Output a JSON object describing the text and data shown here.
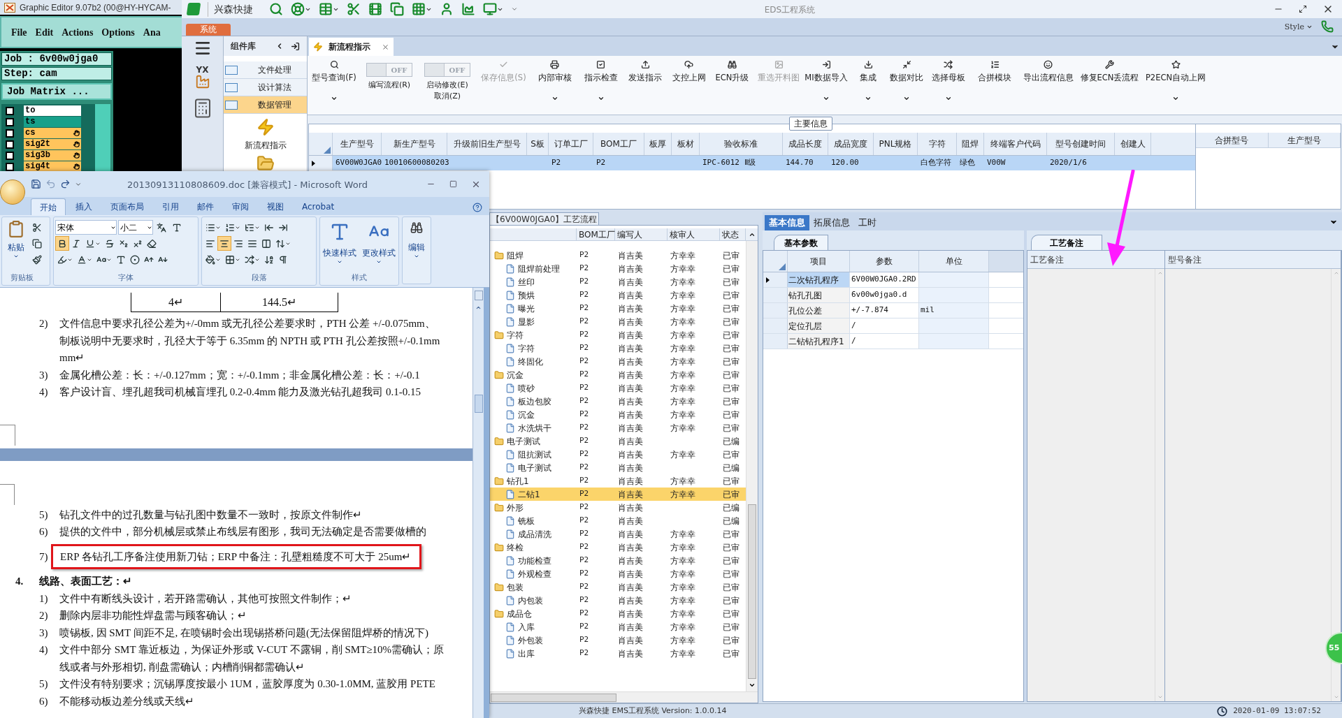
{
  "graphic_editor": {
    "title": "Graphic Editor 9.07b2 (00@HY-HYCAM-",
    "menu": [
      "File",
      "Edit",
      "Actions",
      "Options",
      "Ana"
    ],
    "job": "Job : 6v00w0jga0",
    "step": "Step: cam",
    "matrix_button": "Job Matrix ...",
    "layers": [
      {
        "name": "to",
        "color": "#ffffff",
        "kind": "plain",
        "checked": false
      },
      {
        "name": "ts",
        "color": "#17a08a",
        "kind": "plain",
        "checked": false
      },
      {
        "name": "cs",
        "color": "#ffc45c",
        "kind": "signal",
        "checked": false
      },
      {
        "name": "sig2t",
        "color": "#ffc45c",
        "kind": "signal",
        "checked": false
      },
      {
        "name": "sig3b",
        "color": "#ffc45c",
        "kind": "signal",
        "checked": false
      },
      {
        "name": "sig4t",
        "color": "#ffc45c",
        "kind": "signal",
        "checked": false
      }
    ]
  },
  "eds": {
    "title": "EDS工程系统",
    "quick_access_label": "兴森快捷",
    "system_tab": "系统",
    "style_label": "Style",
    "nav_badge": "YX",
    "component_panel": {
      "title": "组件库",
      "items": [
        {
          "label": "文件处理",
          "selected": false
        },
        {
          "label": "设计算法",
          "selected": false
        },
        {
          "label": "数据管理",
          "selected": true
        }
      ],
      "tool": "新流程指示"
    },
    "tabs": [
      {
        "label": "新流程指示",
        "selected": true
      }
    ],
    "ribbon": [
      {
        "kind": "button",
        "label": "型号查询(F)",
        "has_menu": true,
        "disabled": false
      },
      {
        "kind": "toggle",
        "state_text": "OFF",
        "on": false,
        "label": "编写流程(R)"
      },
      {
        "kind": "toggle",
        "state_text": "OFF",
        "on": false,
        "label": "启动修改(E)",
        "sub_label": "取消(Z)"
      },
      {
        "kind": "button",
        "label": "保存信息(S)",
        "has_menu": false,
        "disabled": true
      },
      {
        "kind": "button",
        "label": "内部审核",
        "has_menu": true,
        "disabled": false
      },
      {
        "kind": "button",
        "label": "指示检查",
        "has_menu": true,
        "disabled": false
      },
      {
        "kind": "button",
        "label": "发送指示",
        "has_menu": false,
        "disabled": false
      },
      {
        "kind": "button",
        "label": "文控上网",
        "has_menu": false,
        "disabled": false
      },
      {
        "kind": "button",
        "label": "ECN升级",
        "has_menu": false,
        "disabled": false
      },
      {
        "kind": "button",
        "label": "重选开料图",
        "has_menu": false,
        "disabled": true
      },
      {
        "kind": "button",
        "label": "MI数据导入",
        "has_menu": true,
        "disabled": false
      },
      {
        "kind": "button",
        "label": "集成",
        "has_menu": true,
        "disabled": false
      },
      {
        "kind": "button",
        "label": "数据对比",
        "has_menu": true,
        "disabled": false
      },
      {
        "kind": "button",
        "label": "选择母板",
        "has_menu": true,
        "disabled": false
      },
      {
        "kind": "button",
        "label": "合拼模块",
        "has_menu": false,
        "disabled": false
      },
      {
        "kind": "button",
        "label": "导出流程信息",
        "has_menu": false,
        "disabled": false
      },
      {
        "kind": "button",
        "label": "修复ECN丢流程",
        "has_menu": false,
        "disabled": false
      },
      {
        "kind": "button",
        "label": "P2ECN自动上网",
        "has_menu": true,
        "disabled": false
      }
    ],
    "main_info": {
      "caption": "主要信息",
      "columns": [
        "生产型号",
        "新生产型号",
        "升级前旧生产型号",
        "S板",
        "订单工厂",
        "BOM工厂",
        "板厚",
        "板材",
        "验收标准",
        "成品长度",
        "成品宽度",
        "PNL规格",
        "字符",
        "阻焊",
        "终端客户代码",
        "型号创建时间",
        "创建人"
      ],
      "rows": [
        {
          "selected": true,
          "cells": [
            "6V00W0JGA0",
            "10010600080203",
            null,
            null,
            "P2",
            "P2",
            null,
            null,
            "IPC-6012 Ⅱ级",
            "144.70",
            "120.00",
            null,
            "白色字符",
            "绿色",
            "V00W",
            "2020/1/6",
            null
          ]
        }
      ],
      "side_columns": [
        "合拼型号",
        "生产型号"
      ]
    },
    "process_flow": {
      "tab": "【6V00W0JGA0】工艺流程",
      "columns": [
        "BOM工厂",
        "编写人",
        "核审人",
        "状态"
      ],
      "steps": [
        {
          "name": "阻焊",
          "kind": "folder",
          "bom": "P2",
          "author": "肖吉美",
          "reviewer": "方幸幸",
          "status": "已审",
          "selected": false,
          "children": [
            {
              "name": "阻焊前处理",
              "kind": "file",
              "bom": "P2",
              "author": "肖吉美",
              "reviewer": "方幸幸",
              "status": "已审",
              "selected": false
            },
            {
              "name": "丝印",
              "kind": "file",
              "bom": "P2",
              "author": "肖吉美",
              "reviewer": "方幸幸",
              "status": "已审",
              "selected": false
            },
            {
              "name": "预烘",
              "kind": "file",
              "bom": "P2",
              "author": "肖吉美",
              "reviewer": "方幸幸",
              "status": "已审",
              "selected": false
            },
            {
              "name": "曝光",
              "kind": "file",
              "bom": "P2",
              "author": "肖吉美",
              "reviewer": "方幸幸",
              "status": "已审",
              "selected": false
            },
            {
              "name": "显影",
              "kind": "file",
              "bom": "P2",
              "author": "肖吉美",
              "reviewer": "方幸幸",
              "status": "已审",
              "selected": false
            }
          ]
        },
        {
          "name": "字符",
          "kind": "folder",
          "bom": "P2",
          "author": "肖吉美",
          "reviewer": "方幸幸",
          "status": "已审",
          "selected": false,
          "children": [
            {
              "name": "字符",
              "kind": "file",
              "bom": "P2",
              "author": "肖吉美",
              "reviewer": "方幸幸",
              "status": "已审",
              "selected": false
            },
            {
              "name": "终固化",
              "kind": "file",
              "bom": "P2",
              "author": "肖吉美",
              "reviewer": "方幸幸",
              "status": "已审",
              "selected": false
            }
          ]
        },
        {
          "name": "沉金",
          "kind": "folder",
          "bom": "P2",
          "author": "肖吉美",
          "reviewer": "方幸幸",
          "status": "已审",
          "selected": false,
          "children": [
            {
              "name": "喷砂",
              "kind": "file",
              "bom": "P2",
              "author": "肖吉美",
              "reviewer": "方幸幸",
              "status": "已审",
              "selected": false
            },
            {
              "name": "板边包胶",
              "kind": "file",
              "bom": "P2",
              "author": "肖吉美",
              "reviewer": "方幸幸",
              "status": "已审",
              "selected": false
            },
            {
              "name": "沉金",
              "kind": "file",
              "bom": "P2",
              "author": "肖吉美",
              "reviewer": "方幸幸",
              "status": "已审",
              "selected": false
            },
            {
              "name": "水洗烘干",
              "kind": "file",
              "bom": "P2",
              "author": "肖吉美",
              "reviewer": "方幸幸",
              "status": "已审",
              "selected": false
            }
          ]
        },
        {
          "name": "电子测试",
          "kind": "folder",
          "bom": "P2",
          "author": "肖吉美",
          "status": "已编",
          "selected": false,
          "children": [
            {
              "name": "阻抗测试",
              "kind": "file",
              "bom": "P2",
              "author": "肖吉美",
              "reviewer": "方幸幸",
              "status": "已审",
              "selected": false
            },
            {
              "name": "电子测试",
              "kind": "file",
              "bom": "P2",
              "author": "肖吉美",
              "status": "已编",
              "selected": false
            }
          ]
        },
        {
          "name": "钻孔1",
          "kind": "folder",
          "bom": "P2",
          "author": "肖吉美",
          "reviewer": "方幸幸",
          "status": "已审",
          "selected": false,
          "children": [
            {
              "name": "二钻1",
              "kind": "file",
              "bom": "P2",
              "author": "肖吉美",
              "reviewer": "方幸幸",
              "status": "已审",
              "selected": true
            }
          ]
        },
        {
          "name": "外形",
          "kind": "folder",
          "bom": "P2",
          "author": "肖吉美",
          "status": "已编",
          "selected": false,
          "children": [
            {
              "name": "铣板",
              "kind": "file",
              "bom": "P2",
              "author": "肖吉美",
              "status": "已编",
              "selected": false
            },
            {
              "name": "成品清洗",
              "kind": "file",
              "bom": "P2",
              "author": "肖吉美",
              "reviewer": "方幸幸",
              "status": "已审",
              "selected": false
            }
          ]
        },
        {
          "name": "终检",
          "kind": "folder",
          "bom": "P2",
          "author": "肖吉美",
          "reviewer": "方幸幸",
          "status": "已审",
          "selected": false,
          "children": [
            {
              "name": "功能检查",
              "kind": "file",
              "bom": "P2",
              "author": "肖吉美",
              "reviewer": "方幸幸",
              "status": "已审",
              "selected": false
            },
            {
              "name": "外观检查",
              "kind": "file",
              "bom": "P2",
              "author": "肖吉美",
              "reviewer": "方幸幸",
              "status": "已审",
              "selected": false
            }
          ]
        },
        {
          "name": "包装",
          "kind": "folder",
          "bom": "P2",
          "author": "肖吉美",
          "reviewer": "方幸幸",
          "status": "已审",
          "selected": false,
          "children": [
            {
              "name": "内包装",
              "kind": "file",
              "bom": "P2",
              "author": "肖吉美",
              "reviewer": "方幸幸",
              "status": "已审",
              "selected": false
            }
          ]
        },
        {
          "name": "成品仓",
          "kind": "folder",
          "bom": "P2",
          "author": "肖吉美",
          "reviewer": "方幸幸",
          "status": "已审",
          "selected": false,
          "children": [
            {
              "name": "入库",
              "kind": "file",
              "bom": "P2",
              "author": "肖吉美",
              "reviewer": "方幸幸",
              "status": "已审",
              "selected": false
            },
            {
              "name": "外包装",
              "kind": "file",
              "bom": "P2",
              "author": "肖吉美",
              "reviewer": "方幸幸",
              "status": "已审",
              "selected": false
            },
            {
              "name": "出库",
              "kind": "file",
              "bom": "P2",
              "author": "肖吉美",
              "reviewer": "方幸幸",
              "status": "已审",
              "selected": false
            }
          ]
        }
      ]
    },
    "detail_tabs": [
      {
        "label": "基本信息",
        "selected": true
      },
      {
        "label": "拓展信息",
        "selected": false
      },
      {
        "label": "工时",
        "selected": false
      }
    ],
    "basic_params": {
      "tab": "基本参数",
      "columns": [
        "项目",
        "参数",
        "单位"
      ],
      "rows": [
        {
          "item": "二次钻孔程序",
          "value": "6V00W0JGA0.2RD",
          "selected": true
        },
        {
          "item": "钻孔孔图",
          "value": "6v00w0jga0.d",
          "selected": false
        },
        {
          "item": "孔位公差",
          "value": "+/-7.874",
          "unit": "mil",
          "selected": false
        },
        {
          "item": "定位孔层",
          "value": "/",
          "selected": false
        },
        {
          "item": "二钻钻孔程序1",
          "value": "/",
          "selected": false
        }
      ]
    },
    "notes": {
      "tab": "工艺备注",
      "columns": [
        "工艺备注",
        "型号备注"
      ]
    },
    "status_bar": {
      "text": "兴森快捷 EMS工程系统 Version: 1.0.0.14",
      "datetime": "2020-01-09 13:07:52"
    },
    "badge": "55"
  },
  "word": {
    "title": "20130913110808609.doc [兼容模式] - Microsoft Word",
    "tabs": [
      {
        "label": "开始",
        "selected": true
      },
      {
        "label": "插入",
        "selected": false
      },
      {
        "label": "页面布局",
        "selected": false
      },
      {
        "label": "引用",
        "selected": false
      },
      {
        "label": "邮件",
        "selected": false
      },
      {
        "label": "审阅",
        "selected": false
      },
      {
        "label": "视图",
        "selected": false
      },
      {
        "label": "Acrobat",
        "selected": false
      }
    ],
    "ribbon": {
      "paste": "粘贴",
      "font_name": "宋体",
      "font_size": "小二",
      "bold": true,
      "align_buttons": [
        {
          "selected": false
        },
        {
          "selected": true
        },
        {
          "selected": false
        },
        {
          "selected": false
        },
        {
          "selected": false
        }
      ],
      "quick_styles": "快速样式",
      "change_styles": "更改样式",
      "edit": "编辑",
      "groups": [
        "剪贴板",
        "字体",
        "段落",
        "样式"
      ]
    },
    "document": {
      "table_cells": [
        "4↵",
        "144.5↵"
      ],
      "blocks": [
        {
          "kind": "item",
          "number": "2)",
          "highlighted": false,
          "lines": [
            "文件信息中要求孔径公差为+/-0mm 或无孔径公差要求时，PTH 公差 +/-0.075mm、",
            "制板说明中无要求时，孔径大于等于 6.35mm 的 NPTH 或 PTH 孔公差按照+/-0.1mm",
            "mm↵"
          ]
        },
        {
          "kind": "item",
          "number": "3)",
          "highlighted": false,
          "lines": [
            "金属化槽公差：长：+/-0.127mm；宽：+/-0.1mm；非金属化槽公差：长：+/-0.1"
          ]
        },
        {
          "kind": "item",
          "number": "4)",
          "highlighted": false,
          "lines": [
            "客户设计盲、埋孔超我司机械盲埋孔 0.2-0.4mm 能力及激光钻孔超我司 0.1-0.15"
          ]
        },
        {
          "kind": "page_break"
        },
        {
          "kind": "item",
          "number": "5)",
          "highlighted": false,
          "lines": [
            "钻孔文件中的过孔数量与钻孔图中数量不一致时，按原文件制作↵"
          ]
        },
        {
          "kind": "item",
          "number": "6)",
          "highlighted": false,
          "lines": [
            "提供的文件中，部分机械层或禁止布线层有图形，我司无法确定是否需要做槽的"
          ]
        },
        {
          "kind": "item",
          "number": "7)",
          "highlighted": true,
          "lines": [
            "ERP 各钻孔工序备注使用新刀钻；ERP 中备注：孔壁粗糙度不可大于 25um↵"
          ]
        },
        {
          "kind": "heading",
          "number": "4.",
          "lines": [
            "线路、表面工艺：↵"
          ]
        },
        {
          "kind": "item",
          "number": "1)",
          "highlighted": false,
          "lines": [
            "文件中有断线头设计，若开路需确认，其他可按照文件制作；↵"
          ]
        },
        {
          "kind": "item",
          "number": "2)",
          "highlighted": false,
          "lines": [
            "删除内层非功能性焊盘需与顾客确认；↵"
          ]
        },
        {
          "kind": "item",
          "number": "3)",
          "highlighted": false,
          "lines": [
            "喷锡板, 因 SMT 间距不足, 在喷锡时会出现锡搭桥问题(无法保留阻焊桥的情况下)"
          ]
        },
        {
          "kind": "item",
          "number": "4)",
          "highlighted": false,
          "lines": [
            "文件中部分 SMT 靠近板边，为保证外形或 V-CUT 不露铜，削 SMT≥10%需确认；原",
            "线或者与外形相切, 削盘需确认；内槽削铜都需确认↵"
          ]
        },
        {
          "kind": "item",
          "number": "5)",
          "highlighted": false,
          "lines": [
            "文件没有特别要求；沉锡厚度按最小 1UM，蓝胶厚度为 0.30-1.0MM, 蓝胶用 PETE"
          ]
        },
        {
          "kind": "item",
          "number": "6)",
          "highlighted": false,
          "lines": [
            "不能移动板边差分线或天线↵"
          ]
        }
      ]
    }
  }
}
